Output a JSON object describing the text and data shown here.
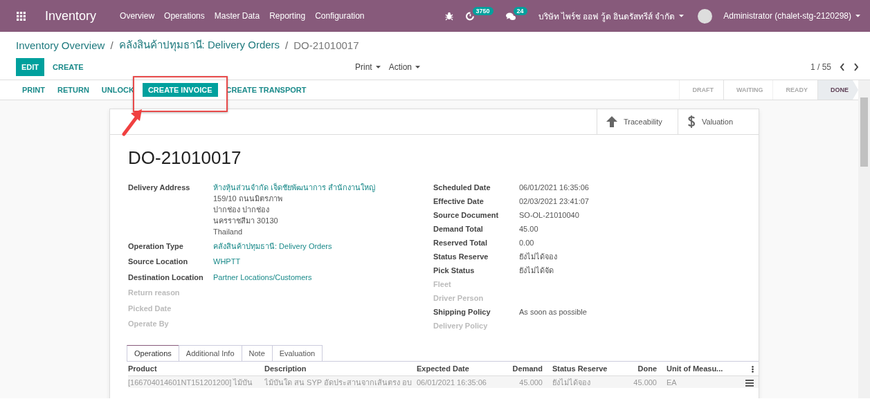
{
  "app": {
    "name": "Inventory",
    "menu": [
      "Overview",
      "Operations",
      "Master Data",
      "Reporting",
      "Configuration"
    ]
  },
  "systray": {
    "counters": [
      {
        "kind": "activity",
        "count": "3750"
      },
      {
        "kind": "chat",
        "count": "24"
      }
    ],
    "company": "บริษัท ไพร์ช ออฟ วู้ด อินดรัสทรีส์ จำกัด",
    "user": "Administrator (chalet-stg-2120298)"
  },
  "breadcrumbs": [
    {
      "kind": "link",
      "label": "Inventory Overview"
    },
    {
      "kind": "separator",
      "label": "/"
    },
    {
      "kind": "link",
      "label": "คลังสินค้าปทุมธานี: Delivery Orders"
    },
    {
      "kind": "separator",
      "label": "/"
    },
    {
      "kind": "current",
      "label": "DO-21010017"
    }
  ],
  "main_buttons": [
    {
      "label": "EDIT",
      "primary": true
    },
    {
      "label": "CREATE",
      "primary": false
    }
  ],
  "dropdowns": [
    "Print",
    "Action"
  ],
  "pager": "1 / 55",
  "header_buttons": [
    {
      "label": "PRINT",
      "primary": false,
      "marked": false
    },
    {
      "label": "RETURN",
      "primary": false,
      "marked": false
    },
    {
      "label": "UNLOCK",
      "primary": false,
      "marked": false
    },
    {
      "label": "CREATE INVOICE",
      "primary": true,
      "marked": true
    },
    {
      "label": "CREATE TRANSPORT",
      "primary": false,
      "marked": false
    }
  ],
  "stages": [
    {
      "label": "DRAFT",
      "selected": false
    },
    {
      "label": "WAITING",
      "selected": false
    },
    {
      "label": "READY",
      "selected": false
    },
    {
      "label": "DONE",
      "selected": true
    }
  ],
  "annotations": [
    {
      "kind": "arrow"
    }
  ],
  "smart_buttons": [
    {
      "kind": "traceability",
      "label": "Traceability"
    },
    {
      "kind": "valuation",
      "label": "Valuation"
    }
  ],
  "title": "DO-21010017",
  "left_fields": [
    {
      "label": "Delivery Address",
      "empty": false,
      "lines": [
        {
          "text": "ห้างหุ้นส่วนจำกัด เจ็ดชัยพัฒนาการ สำนักงานใหญ่",
          "link": true
        },
        {
          "text": "159/10 ถนนมิตรภาพ",
          "link": false
        },
        {
          "text": "ปากช่อง ปากช่อง",
          "link": false
        },
        {
          "text": "นครราชสีมา 30130",
          "link": false
        },
        {
          "text": "Thailand",
          "link": false
        }
      ]
    },
    {
      "label": "Operation Type",
      "empty": false,
      "lines": [
        {
          "text": "คลังสินค้าปทุมธานี: Delivery Orders",
          "link": true
        }
      ]
    },
    {
      "label": "Source Location",
      "empty": false,
      "lines": [
        {
          "text": "WHPTT",
          "link": true
        }
      ]
    },
    {
      "label": "Destination Location",
      "empty": false,
      "lines": [
        {
          "text": "Partner Locations/Customers",
          "link": true
        }
      ]
    },
    {
      "label": "Return reason",
      "empty": true
    },
    {
      "label": "Picked Date",
      "empty": true
    },
    {
      "label": "Operate By",
      "empty": true
    }
  ],
  "right_fields": [
    {
      "label": "Scheduled Date",
      "empty": false,
      "lines": [
        {
          "text": "06/01/2021 16:35:06",
          "link": false
        }
      ]
    },
    {
      "label": "Effective Date",
      "empty": false,
      "lines": [
        {
          "text": "02/03/2021 23:41:07",
          "link": false
        }
      ]
    },
    {
      "label": "Source Document",
      "empty": false,
      "lines": [
        {
          "text": "SO-OL-21010040",
          "link": false
        }
      ]
    },
    {
      "label": "Demand Total",
      "empty": false,
      "lines": [
        {
          "text": "45.00",
          "link": false
        }
      ]
    },
    {
      "label": "Reserved Total",
      "empty": false,
      "lines": [
        {
          "text": "0.00",
          "link": false
        }
      ]
    },
    {
      "label": "Status Reserve",
      "empty": false,
      "lines": [
        {
          "text": "ยังไม่ได้จอง",
          "link": false
        }
      ]
    },
    {
      "label": "Pick Status",
      "empty": false,
      "lines": [
        {
          "text": "ยังไม่ได้จัด",
          "link": false
        }
      ]
    },
    {
      "label": "Fleet",
      "empty": true
    },
    {
      "label": "Driver Person",
      "empty": true
    },
    {
      "label": "Shipping Policy",
      "empty": false,
      "lines": [
        {
          "text": "As soon as possible",
          "link": false
        }
      ]
    },
    {
      "label": "Delivery Policy",
      "empty": true
    }
  ],
  "tabs": [
    {
      "label": "Operations",
      "selected": true
    },
    {
      "label": "Additional Info",
      "selected": false
    },
    {
      "label": "Note",
      "selected": false
    },
    {
      "label": "Evaluation",
      "selected": false
    }
  ],
  "table": {
    "columns": [
      "Product",
      "Description",
      "Expected Date",
      "Demand",
      "Status Reserve",
      "Done",
      "Unit of Measu..."
    ],
    "rows": [
      [
        "[166704014601NT151201200] ไม้บัน",
        "ไม้บันใด สน SYP อัดประสานจากเส้นตรง อบ",
        "06/01/2021 16:35:06",
        "45.000",
        "ยังไม่ได้จอง",
        "45.000",
        "EA"
      ]
    ]
  }
}
